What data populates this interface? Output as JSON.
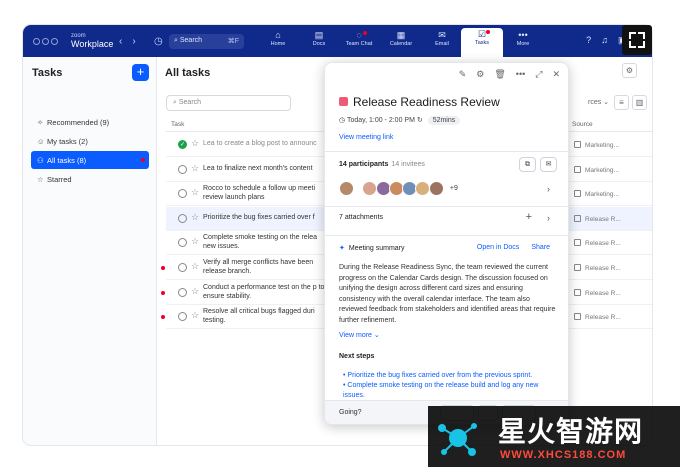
{
  "topbar": {
    "brand_small": "zoom",
    "brand": "Workplace",
    "search_placeholder": "Search",
    "search_shortcut": "⌘F",
    "nav": [
      {
        "label": "Home",
        "icon": "home-icon",
        "glyph": "⌂"
      },
      {
        "label": "Docs",
        "icon": "docs-icon",
        "glyph": "▤"
      },
      {
        "label": "Team Chat",
        "icon": "chat-icon",
        "glyph": "◌"
      },
      {
        "label": "Calendar",
        "icon": "calendar-icon",
        "glyph": "▦"
      },
      {
        "label": "Email",
        "icon": "email-icon",
        "glyph": "✉"
      },
      {
        "label": "Tasks",
        "icon": "tasks-icon",
        "glyph": "☑"
      },
      {
        "label": "More",
        "icon": "more-icon",
        "glyph": "•••"
      }
    ]
  },
  "sidebar": {
    "title": "Tasks",
    "items": [
      {
        "label": "Recommended (9)",
        "icon": "sparkle-icon",
        "glyph": "✧"
      },
      {
        "label": "My tasks (2)",
        "icon": "user-icon",
        "glyph": "☺"
      },
      {
        "label": "All tasks (8)",
        "icon": "group-icon",
        "glyph": "⚇"
      },
      {
        "label": "Starred",
        "icon": "star-icon",
        "glyph": "☆"
      }
    ]
  },
  "main": {
    "title": "All tasks",
    "search_placeholder": "Search",
    "col_task": "Task",
    "col_source": "Source",
    "filter_fragment": "rces",
    "rows": [
      {
        "text": "Lea to create a blog post to announc",
        "source": "Marketing...",
        "done": true,
        "flag": false
      },
      {
        "text": "Lea to finalize next month's content",
        "source": "Marketing...",
        "done": false,
        "flag": false
      },
      {
        "text": "Rocco to schedule a follow up meeti review launch plans",
        "source": "Marketing...",
        "done": false,
        "flag": false
      },
      {
        "text": "Prioritize the bug fixes carried over f",
        "source": "Release R...",
        "done": false,
        "flag": false
      },
      {
        "text": "Complete smoke testing on the relea new issues.",
        "source": "Release R...",
        "done": false,
        "flag": false
      },
      {
        "text": "Verify all merge conflicts have been release branch.",
        "source": "Release R...",
        "done": false,
        "flag": true
      },
      {
        "text": "Conduct a performance test on the p to ensure stability.",
        "source": "Release R...",
        "done": false,
        "flag": true
      },
      {
        "text": "Resolve all critical bugs flagged duri testing.",
        "source": "Release R...",
        "done": false,
        "flag": true
      }
    ]
  },
  "panel": {
    "title": "Release Readiness Review",
    "time": "Today, 1:00 - 2:00 PM",
    "duration": "52mins",
    "meeting_link": "View meeting link",
    "participants": "14 participants",
    "invitees": "14 invitees",
    "more_avatars": "+9",
    "attachments": "7 attachments",
    "summary_title": "Meeting summary",
    "open_docs": "Open in Docs",
    "share": "Share",
    "summary": "During the Release Readiness Sync, the team reviewed the current progress on the Calendar Cards design. The discussion focused on unifying the design across different card sizes and ensuring consistency with the overall calendar interface. The team also reviewed feedback from stakeholders and identified areas that require further refinement.",
    "view_more": "View more",
    "next_steps_title": "Next steps",
    "next_steps": [
      "Prioritize the bug fixes carried over from the previous sprint.",
      "Complete smoke testing on the release build and log any new issues."
    ],
    "going": "Going?"
  },
  "watermark": {
    "cn": "星火智游网",
    "url": "WWW.XHCS188.COM"
  },
  "colors": {
    "topbar": "#0f2a8a",
    "accent": "#0b5cff",
    "event": "#ef5b75"
  }
}
